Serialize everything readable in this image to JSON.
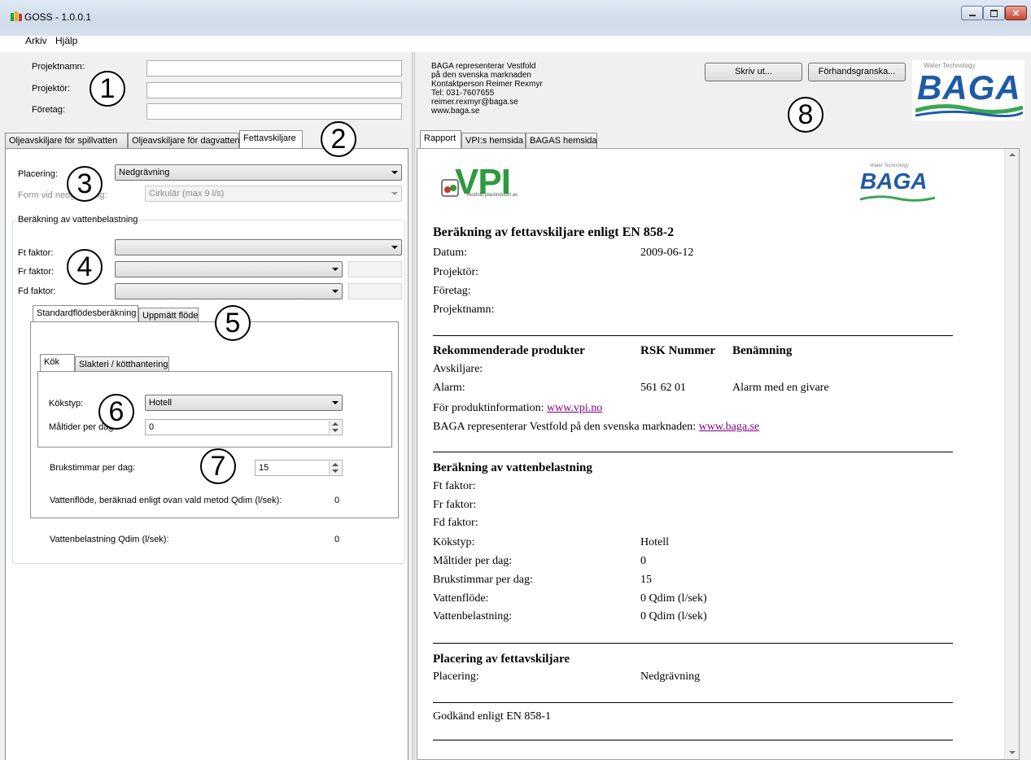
{
  "window": {
    "title": "GOSS - 1.0.0.1"
  },
  "menu": {
    "items": [
      "Arkiv",
      "Hjälp"
    ]
  },
  "project": {
    "name_label": "Projektnamn:",
    "designer_label": "Projektör:",
    "company_label": "Företag:",
    "name_value": "",
    "designer_value": "",
    "company_value": ""
  },
  "left_tabs": [
    "Oljeavskiljare för spillvatten",
    "Oljeavskiljare för dagvatten",
    "Fettavskiljare"
  ],
  "placement": {
    "label": "Placering:",
    "value": "Nedgrävning",
    "form_label": "Form vid nedgrävning:",
    "form_value": "Cirkulär (max 9 l/s)"
  },
  "calc": {
    "group_title": "Beräkning av vattenbelastning",
    "ft_label": "Ft faktor:",
    "fr_label": "Fr faktor:",
    "fd_label": "Fd faktor:",
    "tabs": [
      "Standardflödesberäkning",
      "Uppmätt flöde"
    ],
    "kitchen_tabs": [
      "Kök",
      "Slakteri / kötthantering"
    ],
    "kitchen_type_label": "Kökstyp:",
    "kitchen_type_value": "Hotell",
    "meals_label": "Måltider per dag:",
    "meals_value": "0",
    "hours_label": "Brukstimmar per dag:",
    "hours_value": "15",
    "flow_label": "Vattenflöde, beräknad enligt ovan vald metod  Qdim (l/sek):",
    "flow_value": "0",
    "load_label": "Vattenbelastning Qdim (l/sek):",
    "load_value": "0"
  },
  "callouts": [
    "1",
    "2",
    "3",
    "4",
    "5",
    "6",
    "7",
    "8"
  ],
  "company_info": [
    "BAGA representerar Vestfold",
    "på den svenska marknaden",
    "Kontaktperson Reimer Rexmyr",
    "Tel: 031-7607655",
    "reimer.rexmyr@baga.se",
    "www.baga.se"
  ],
  "buttons": {
    "print": "Skriv ut...",
    "preview": "Förhandsgranska..."
  },
  "logo": {
    "tagline": "Water Technology",
    "name": "BAGA",
    "vpi": "VPI",
    "vpi_sub": "Vestfold plastindustri as"
  },
  "right_tabs": [
    "Rapport",
    "VPI:s hemsida",
    "BAGAS hemsida"
  ],
  "report": {
    "title": "Beräkning av fettavskiljare enligt EN 858-2",
    "date_label": "Datum:",
    "date_value": "2009-06-12",
    "designer_label": "Projektör:",
    "company_label": "Företag:",
    "project_label": "Projektnamn:",
    "products_heading": "Rekommenderade produkter",
    "rsk_heading": "RSK Nummer",
    "name_heading": "Benämning",
    "separator_label": "Avskiljare:",
    "alarm_label": "Alarm:",
    "alarm_rsk": "561 62 01",
    "alarm_name": "Alarm med en givare",
    "product_info_text": "För produktinformation: ",
    "product_info_link": "www.vpi.no",
    "baga_text": "BAGA representerar Vestfold på den svenska marknaden: ",
    "baga_link": "www.baga.se",
    "load_heading": "Beräkning av vattenbelastning",
    "ft_label": "Ft faktor:",
    "fr_label": "Fr faktor:",
    "fd_label": "Fd faktor:",
    "kitchen_label": "Kökstyp:",
    "kitchen_value": "Hotell",
    "meals_label": "Måltider per dag:",
    "meals_value": "0",
    "hours_label": "Brukstimmar per dag:",
    "hours_value": "15",
    "flow_label": "Vattenflöde:",
    "flow_value": "0 Qdim (l/sek)",
    "waterload_label": "Vattenbelastning:",
    "waterload_value": "0 Qdim (l/sek)",
    "placement_heading": "Placering av fettavskiljare",
    "placement_label": "Placering:",
    "placement_value": "Nedgrävning",
    "approved": "Godkänd enligt EN 858-1"
  },
  "colors": {
    "baga_blue": "#1f5aa6",
    "baga_green": "#3aa655",
    "vpi_green": "#2e9a3e",
    "link": "#800080"
  }
}
